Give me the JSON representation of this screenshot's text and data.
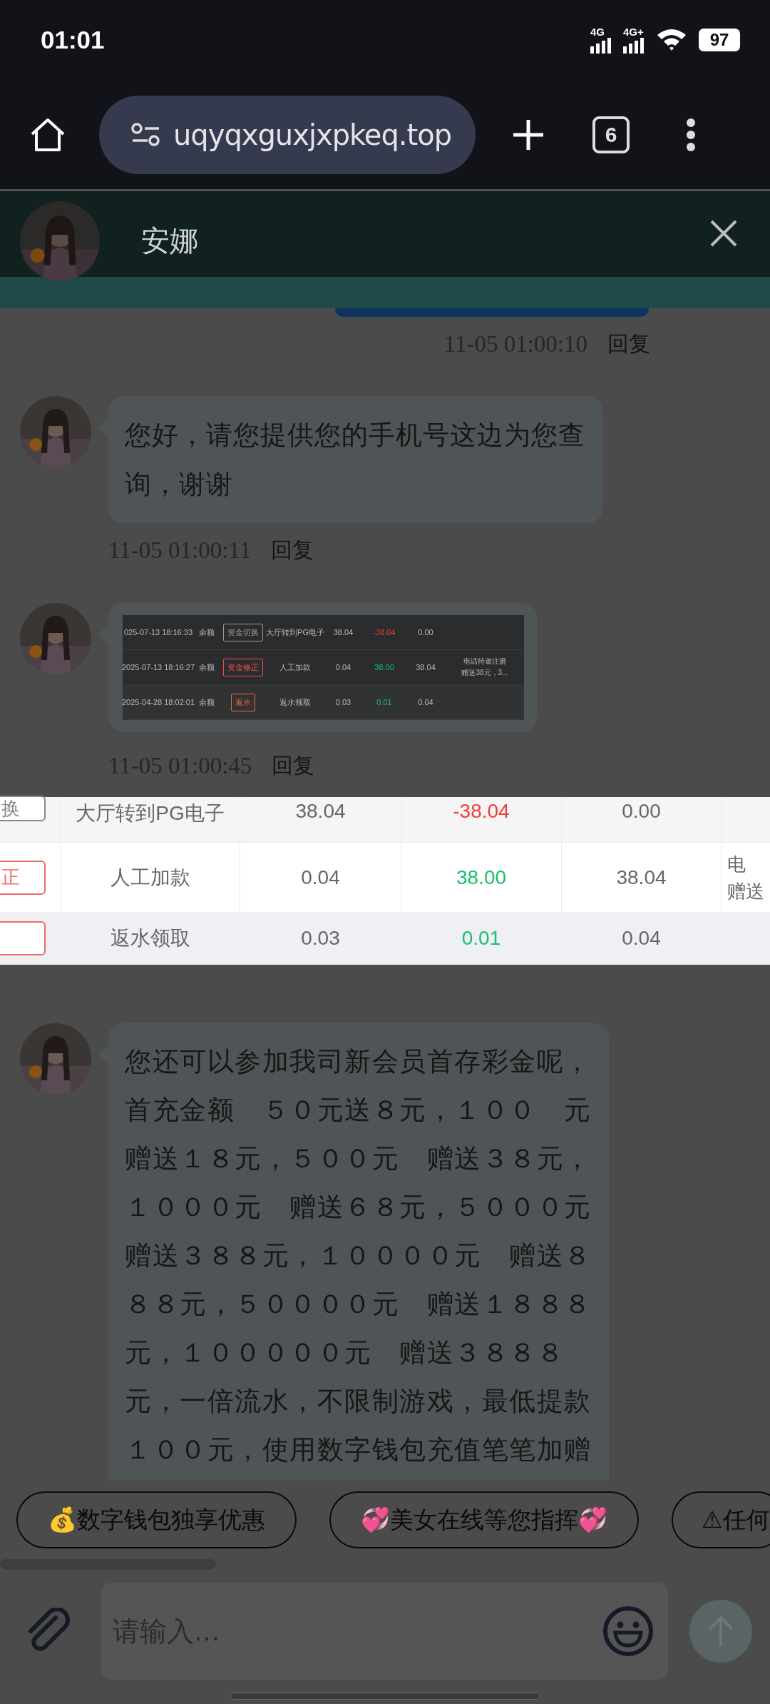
{
  "status_bar": {
    "time": "01:01",
    "network_1": "4G",
    "network_2": "4G+",
    "battery": "97"
  },
  "browser": {
    "url": "uqyqxguxjxpkeq.top",
    "tab_count": "6"
  },
  "chat_header": {
    "name": "安娜"
  },
  "top_meta": {
    "time": "11-05 01:00:10",
    "reply": "回复"
  },
  "messages": [
    {
      "kind": "text",
      "lines": [
        "您好，请您提供您的手机号这边为您查",
        "询，谢谢"
      ],
      "time": "11-05 01:00:11",
      "reply": "回复"
    },
    {
      "rows": [
        {
          "date": "025-07-13 18:16:33",
          "account": "余额",
          "tag": {
            "text": "资金切换",
            "color": "#999999"
          },
          "desc": "大厅转到PG电子",
          "amount": "38.04",
          "change": {
            "text": "-38.04",
            "color": "#f03c3c"
          },
          "balance": "0.00",
          "note": []
        },
        {
          "date": "2025-07-13 18:16:27",
          "account": "余额",
          "tag": {
            "text": "资金修正",
            "color": "#ef4f4f"
          },
          "desc": "人工加款",
          "amount": "0.04",
          "change": {
            "text": "38.00",
            "color": "#19be6b"
          },
          "balance": "38.04",
          "note": [
            "电话待邀注册",
            "赠送38元，3..."
          ]
        },
        {
          "date": "2025-04-28 18:02:01",
          "account": "余额",
          "tag": {
            "text": "返水",
            "color": "#f06a3c"
          },
          "desc": "返水领取",
          "amount": "0.03",
          "change": {
            "text": "0.01",
            "color": "#19be6b"
          },
          "balance": "0.04",
          "note": []
        }
      ],
      "time": "11-05 01:00:45",
      "reply": "回复"
    },
    {
      "kind": "text",
      "lines": [
        "您还可以参加我司新会员首存彩金呢，",
        "首充金额　５０元送８元，１００　元",
        "赠送１８元，５００元　赠送３８元，",
        "１０００元　赠送６８元，５０００元",
        "赠送３８８元，１００００元　赠送８",
        "８８元，５００００元　赠送１８８８",
        "元，１０００００元　赠送３８８８",
        "元，一倍流水，不限制游戏，最低提款",
        "１００元，使用数字钱包充值笔笔加赠"
      ]
    }
  ],
  "image_preview": {
    "rows": [
      {
        "tag": {
          "text": "换",
          "color": "#888888"
        },
        "desc": "大厅转到PG电子",
        "amount": "38.04",
        "change": {
          "text": "-38.04",
          "color": "#f03c3c"
        },
        "balance": "0.00",
        "note": []
      },
      {
        "tag": {
          "text": "正",
          "color": "#f06a6a"
        },
        "desc": "人工加款",
        "amount": "0.04",
        "change": {
          "text": "38.00",
          "color": "#19be6b"
        },
        "balance": "38.04",
        "note": [
          "电",
          "赠送"
        ]
      },
      {
        "tag": {
          "color": "#f06a6a"
        },
        "desc": "返水领取",
        "amount": "0.03",
        "change": {
          "text": "0.01",
          "color": "#19be6b"
        },
        "balance": "0.04",
        "note": []
      }
    ]
  },
  "quick_replies": [
    "💰数字钱包独享优惠",
    "💞美女在线等您指挥💞",
    "⚠任何"
  ],
  "composer": {
    "placeholder": "请输入..."
  }
}
